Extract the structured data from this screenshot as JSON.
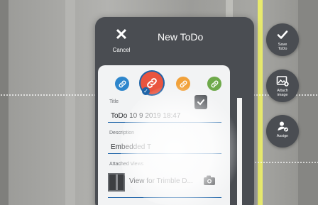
{
  "header": {
    "title": "New ToDo",
    "cancel_label": "Cancel"
  },
  "colors": {
    "swatches": [
      {
        "name": "blue",
        "hex": "#2e86cc",
        "selected": false
      },
      {
        "name": "red",
        "hex": "#e9543f",
        "selected": true
      },
      {
        "name": "orange",
        "hex": "#f1a13a",
        "selected": false
      },
      {
        "name": "green",
        "hex": "#6ea94a",
        "selected": false
      }
    ],
    "accent": "#1e64a8",
    "panel": "#4a4d52"
  },
  "form": {
    "title_label": "Title",
    "title_value": "ToDo 10 9 2019 18:47",
    "description_label": "Description",
    "description_value": "Embedded T",
    "attached_views_label": "Attached Views",
    "attached_view_value": "View for Trimble D..."
  },
  "side_buttons": [
    {
      "label_line1": "Save",
      "label_line2": "ToDo",
      "icon": "check-icon"
    },
    {
      "label_line1": "Attach",
      "label_line2": "image",
      "icon": "image-add-icon"
    },
    {
      "label_line1": "Assign",
      "label_line2": "",
      "icon": "assign-user-icon"
    }
  ]
}
